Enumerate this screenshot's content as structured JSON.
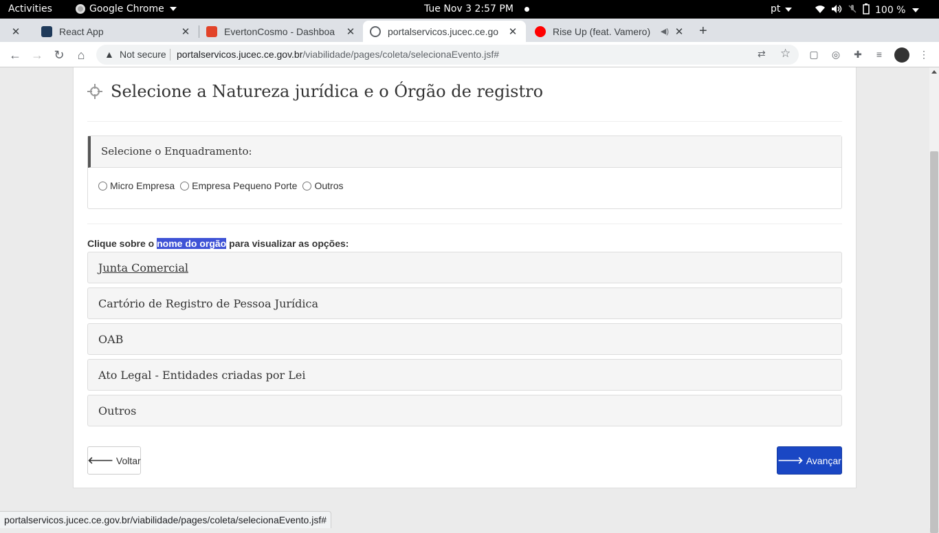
{
  "topbar": {
    "activities": "Activities",
    "app": "Google Chrome",
    "clock": "Tue Nov 3   2:57 PM",
    "lang": "pt",
    "battery": "100 %"
  },
  "tabs": [
    {
      "title": "React App",
      "favicon_color": "#1f3a5a"
    },
    {
      "title": "EvertonCosmo - Dashboa",
      "favicon_color": "#e24329"
    },
    {
      "title": "portalservicos.jucec.ce.go",
      "favicon_color": "#5f6368"
    },
    {
      "title": "Rise Up (feat. Vamero)",
      "favicon_color": "#ff0000"
    }
  ],
  "address": {
    "security": "Not secure",
    "host": "portalservicos.jucec.ce.gov.br",
    "path": "/viabilidade/pages/coleta/selecionaEvento.jsf#"
  },
  "page": {
    "title": "Selecione a Natureza jurídica e o Órgão de registro",
    "enquadramento_label": "Selecione o Enquadramento:",
    "radios": [
      "Micro Empresa",
      "Empresa Pequeno Porte",
      "Outros"
    ],
    "instruction_before": "Clique sobre o ",
    "instruction_highlight": "nome do orgão",
    "instruction_after": " para visualizar as opções:",
    "orgaos": [
      "Junta Comercial",
      "Cartório de Registro de Pessoa Jurídica",
      "OAB",
      "Ato Legal - Entidades criadas por Lei",
      "Outros"
    ],
    "back_label": "Voltar",
    "next_label": "Avançar"
  },
  "statusbar": "portalservicos.jucec.ce.gov.br/viabilidade/pages/coleta/selecionaEvento.jsf#",
  "colors": {
    "primary": "#1a47c4",
    "highlight": "#3f53d6"
  }
}
